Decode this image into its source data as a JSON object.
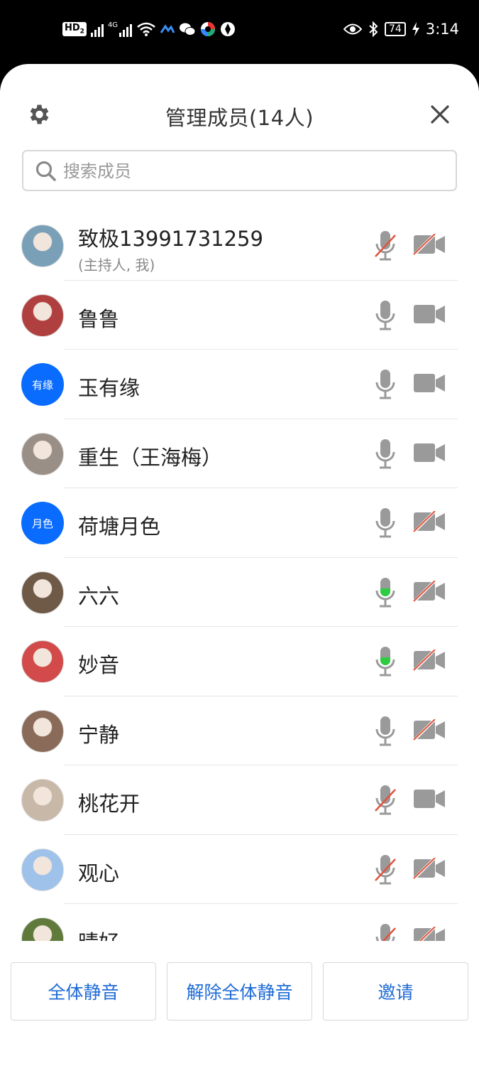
{
  "status_bar": {
    "hd_label": "HD",
    "hd_sub": "2",
    "net_label": "4G",
    "battery": "74",
    "time": "3:14"
  },
  "header": {
    "title": "管理成员(14人)"
  },
  "search": {
    "placeholder": "搜索成员",
    "value": ""
  },
  "members": [
    {
      "name": "致极13991731259",
      "role": "(主持人, 我)",
      "avatar": "photo",
      "avatar_color": "#7aa0b8",
      "mic": "muted",
      "cam": "off"
    },
    {
      "name": "鲁鲁",
      "avatar": "photo",
      "avatar_color": "#b04040",
      "mic": "on",
      "cam": "on"
    },
    {
      "name": "玉有缘",
      "avatar": "text",
      "avatar_text": "有缘",
      "mic": "on",
      "cam": "on"
    },
    {
      "name": "重生（王海梅）",
      "avatar": "photo",
      "avatar_color": "#9a8f86",
      "mic": "on",
      "cam": "on"
    },
    {
      "name": "荷塘月色",
      "avatar": "text",
      "avatar_text": "月色",
      "mic": "on",
      "cam": "off"
    },
    {
      "name": "六六",
      "avatar": "photo",
      "avatar_color": "#6f5a48",
      "mic": "speaking",
      "cam": "off"
    },
    {
      "name": "妙音",
      "avatar": "photo",
      "avatar_color": "#d24a4a",
      "mic": "speaking",
      "cam": "off"
    },
    {
      "name": "宁静",
      "avatar": "photo",
      "avatar_color": "#8a6a58",
      "mic": "on",
      "cam": "off"
    },
    {
      "name": "桃花开",
      "avatar": "photo",
      "avatar_color": "#c8b8a8",
      "mic": "muted",
      "cam": "on"
    },
    {
      "name": "观心",
      "avatar": "photo",
      "avatar_color": "#9ec2ea",
      "mic": "muted",
      "cam": "off"
    },
    {
      "name": "晴好",
      "avatar": "photo",
      "avatar_color": "#5f7a3a",
      "mic": "muted",
      "cam": "off"
    }
  ],
  "footer": {
    "mute_all": "全体静音",
    "unmute_all": "解除全体静音",
    "invite": "邀请"
  },
  "colors": {
    "accent": "#1f6bd6",
    "avatar_blue": "#0a6cff",
    "icon_gray": "#9a9a9a",
    "muted_red": "#e0533d",
    "speaking_green": "#2ecc40"
  }
}
